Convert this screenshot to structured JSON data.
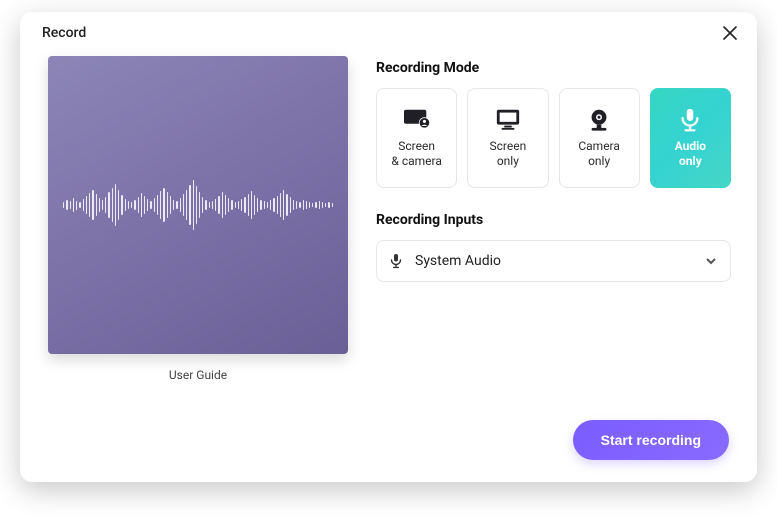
{
  "header": {
    "title": "Record"
  },
  "preview": {
    "guide_label": "User Guide"
  },
  "recording_mode": {
    "label": "Recording Mode",
    "options": [
      {
        "id": "screen-camera",
        "label": "Screen\n& camera",
        "active": false
      },
      {
        "id": "screen-only",
        "label": "Screen\nonly",
        "active": false
      },
      {
        "id": "camera-only",
        "label": "Camera\nonly",
        "active": false
      },
      {
        "id": "audio-only",
        "label": "Audio\nonly",
        "active": true
      }
    ]
  },
  "recording_inputs": {
    "label": "Recording Inputs",
    "selected": "System Audio"
  },
  "actions": {
    "start_label": "Start recording"
  }
}
